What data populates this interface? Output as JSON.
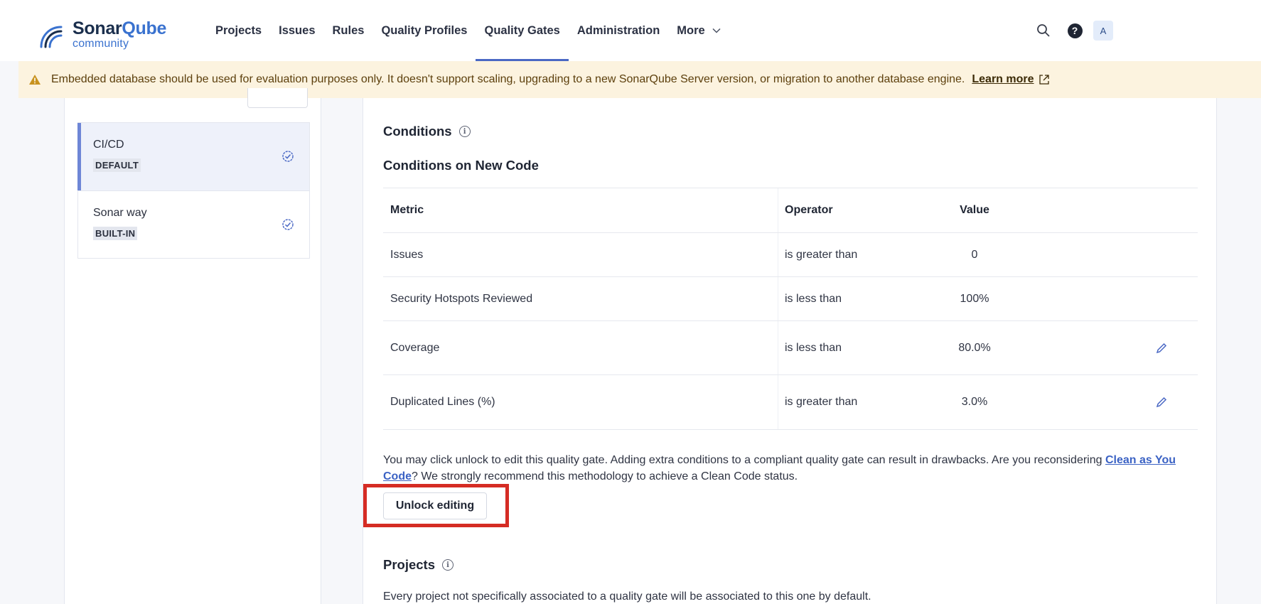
{
  "brand": {
    "name_part1": "Sonar",
    "name_part2": "Qube",
    "edition": "community"
  },
  "nav": {
    "items": [
      {
        "label": "Projects",
        "active": false
      },
      {
        "label": "Issues",
        "active": false
      },
      {
        "label": "Rules",
        "active": false
      },
      {
        "label": "Quality Profiles",
        "active": false
      },
      {
        "label": "Quality Gates",
        "active": true
      },
      {
        "label": "Administration",
        "active": false
      },
      {
        "label": "More",
        "active": false
      }
    ],
    "more_caret": "⌄",
    "help_label": "?",
    "avatar_initial": "A",
    "icons": {
      "search": "search-icon",
      "help": "help-icon"
    }
  },
  "banner": {
    "message": "Embedded database should be used for evaluation purposes only. It doesn't support scaling, upgrading to a new SonarQube Server version, or migration to another database engine.",
    "link": "Learn more",
    "icon": "warning-icon",
    "bg_color": "#fcf3df"
  },
  "gates": [
    {
      "name": "CI/CD",
      "badge": "DEFAULT",
      "selected": true
    },
    {
      "name": "Sonar way",
      "badge": "BUILT-IN",
      "selected": false
    }
  ],
  "conditions": {
    "title": "Conditions",
    "info_glyph": "i",
    "subtitle": "Conditions on New Code",
    "columns": {
      "metric": "Metric",
      "operator": "Operator",
      "value": "Value"
    },
    "rows": [
      {
        "metric": "Issues",
        "operator": "is greater than",
        "value": "0",
        "editable": false
      },
      {
        "metric": "Security Hotspots Reviewed",
        "operator": "is less than",
        "value": "100%",
        "editable": false
      },
      {
        "metric": "Coverage",
        "operator": "is less than",
        "value": "80.0%",
        "editable": true
      },
      {
        "metric": "Duplicated Lines (%)",
        "operator": "is greater than",
        "value": "3.0%",
        "editable": true
      }
    ]
  },
  "note": {
    "text_before": "You may click unlock to edit this quality gate. Adding extra conditions to a compliant quality gate can result in drawbacks. Are you reconsidering ",
    "link": "Clean as You Code",
    "text_after": "? We strongly recommend this methodology to achieve a Clean Code status."
  },
  "unlock_button": "Unlock editing",
  "projects": {
    "title": "Projects",
    "info_glyph": "i",
    "description": "Every project not specifically associated to a quality gate will be associated to this one by default."
  },
  "colors": {
    "accent": "#4a68c4",
    "highlight": "#d52c24",
    "link": "#3b62c4"
  }
}
